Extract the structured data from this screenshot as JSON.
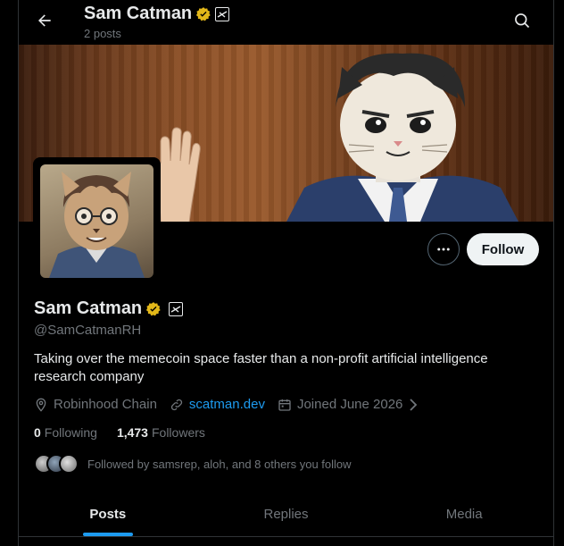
{
  "header": {
    "display_name": "Sam Catman",
    "posts_count": "2 posts"
  },
  "profile": {
    "display_name": "Sam Catman",
    "handle": "@SamCatmanRH",
    "bio": "Taking over the memecoin space faster than a non-profit artificial intelligence research company",
    "location": "Robinhood Chain",
    "website": "scatman.dev",
    "joined": "Joined June 2026",
    "following_count": "0",
    "following_label": "Following",
    "followers_count": "1,473",
    "followers_label": "Followers",
    "followed_by": "Followed by samsrep, aloh, and 8 others you follow"
  },
  "actions": {
    "follow_label": "Follow"
  },
  "tabs": [
    {
      "label": "Posts",
      "active": true
    },
    {
      "label": "Replies",
      "active": false
    },
    {
      "label": "Media",
      "active": false
    }
  ],
  "colors": {
    "accent": "#1d9bf0",
    "verified": "#e2b719",
    "background": "#000000"
  },
  "icons": [
    "back-arrow-icon",
    "search-icon",
    "verified-badge-icon",
    "affiliate-badge-icon",
    "more-icon",
    "location-icon",
    "link-icon",
    "calendar-icon",
    "chevron-right-icon"
  ]
}
